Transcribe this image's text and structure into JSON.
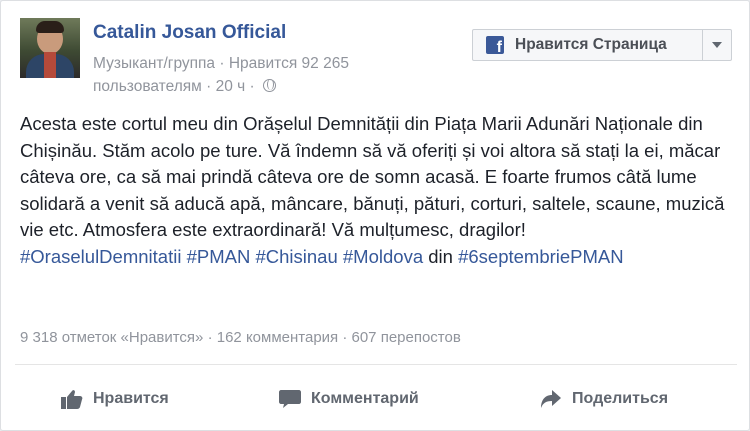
{
  "page": {
    "name": "Catalin Josan Official",
    "category": "Музыкант/группа",
    "likes_text": "Нравится 92 265",
    "likes_suffix": "пользователям",
    "time": "20 ч"
  },
  "like_page_button": {
    "label": "Нравится Страница",
    "icon": "facebook-icon"
  },
  "post": {
    "text": "Acesta este cortul meu din Orășelul Demnității din Piața Marii Adunări Naționale din Chișinău. Stăm acolo pe ture. Vă îndemn să vă oferiți și voi altora să stați la ei, măcar câteva ore, ca să mai prindă câteva ore de somn acasă. E foarte frumos câtă lume solidară a venit să aducă apă, mâncare, bănuți, pături, corturi, saltele, scaune, muzică vie etc. Atmosfera este extraordinară! Vă mulțumesc, dragilor!",
    "hashtags": [
      "#OraselulDemnitatii",
      "#PMAN",
      "#Chisinau",
      "#Moldova"
    ],
    "connector": "din",
    "last_hashtag": "#6septembriePMAN"
  },
  "stats": {
    "likes": "9 318 отметок «Нравится»",
    "comments": "162 комментария",
    "shares": "607 перепостов"
  },
  "actions": {
    "like": "Нравится",
    "comment": "Комментарий",
    "share": "Поделиться"
  },
  "colors": {
    "link": "#365899",
    "muted": "#90949c",
    "text": "#1d2129",
    "facebook_blue": "#3b5998"
  }
}
